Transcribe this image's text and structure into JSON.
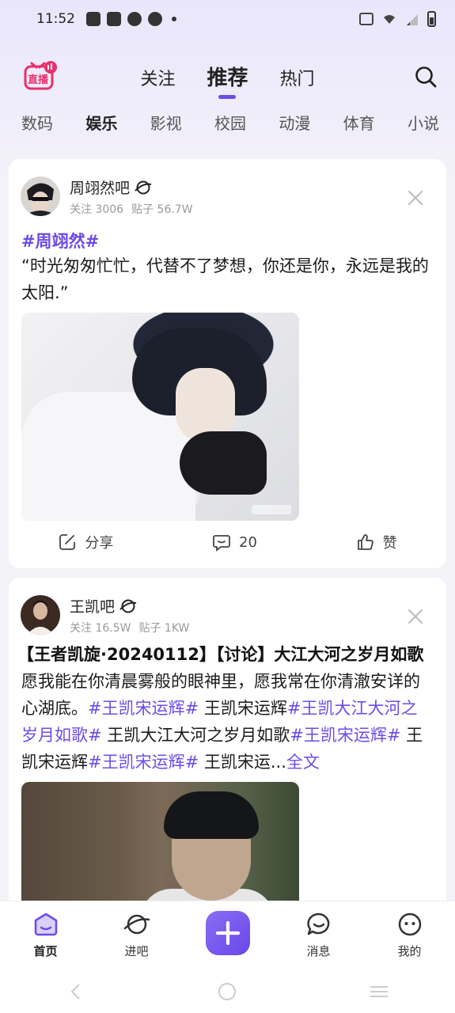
{
  "status_bar": {
    "time": "11:52"
  },
  "header": {
    "logo_text": "直播",
    "tabs": [
      {
        "label": "关注"
      },
      {
        "label": "推荐"
      },
      {
        "label": "热门"
      }
    ]
  },
  "categories": [
    "数码",
    "娱乐",
    "影视",
    "校园",
    "动漫",
    "体育",
    "小说"
  ],
  "posts": [
    {
      "bar_name": "周翊然吧",
      "followers_label": "关注 3006",
      "posts_label": "贴子 56.7W",
      "hashtag": "#周翊然#",
      "text": "“时光匆匆忙忙，代替不了梦想，你还是你，永远是我的太阳.”",
      "actions": {
        "share": "分享",
        "comments": "20",
        "like": "赞"
      }
    },
    {
      "bar_name": "王凯吧",
      "followers_label": "关注 16.5W",
      "posts_label": "贴子 1KW",
      "title": "【王者凯旋·20240112】【讨论】大江大河之岁月如歌",
      "text_a": "愿我能在你清晨雾般的眼神里，愿我常在你清澈安详的心湖底。",
      "tag_1": "#王凯宋运辉#",
      "text_b": " 王凯宋运辉",
      "tag_2": "#王凯大江大河之岁月如歌#",
      "text_c": " 王凯大江大河之岁月如歌",
      "tag_3": "#王凯宋运辉#",
      "text_d": " 王凯宋运辉",
      "tag_4": "#王凯宋运辉#",
      "text_e": " 王凯宋运...",
      "more": "全文"
    }
  ],
  "bottom_nav": [
    {
      "label": "首页"
    },
    {
      "label": "进吧"
    },
    {
      "label": "消息"
    },
    {
      "label": "我的"
    }
  ],
  "colors": {
    "accent": "#6b4ce6",
    "logo": "#e8306a"
  }
}
